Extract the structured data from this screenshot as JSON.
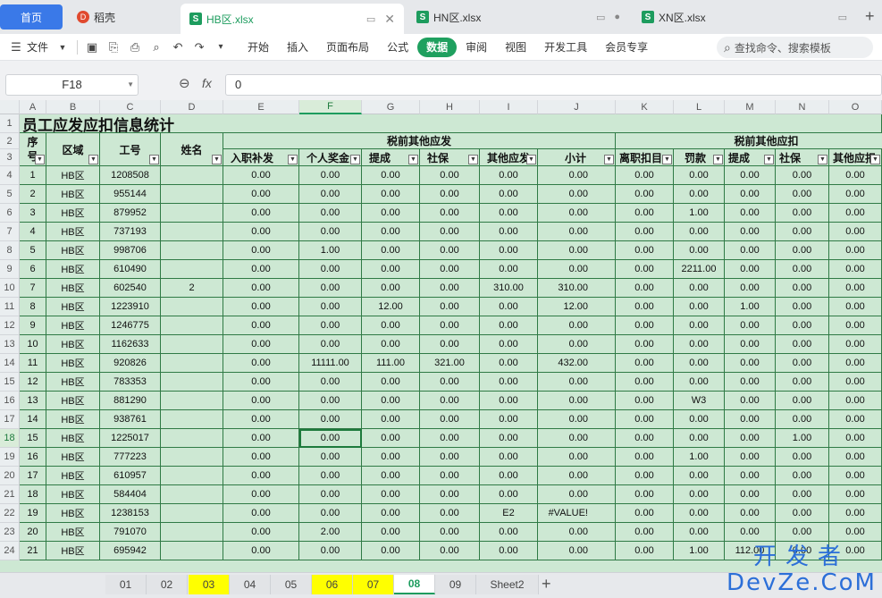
{
  "tabs": {
    "home": "首页",
    "docer": "稻壳",
    "files": [
      {
        "name": "HB区.xlsx",
        "active": true
      },
      {
        "name": "HN区.xlsx",
        "active": false
      },
      {
        "name": "XN区.xlsx",
        "active": false
      }
    ],
    "add": "+"
  },
  "menu": {
    "file": "文件",
    "items": [
      "开始",
      "插入",
      "页面布局",
      "公式",
      "数据",
      "审阅",
      "视图",
      "开发工具",
      "会员专享"
    ],
    "active": "数据",
    "search_placeholder": "查找命令、搜索模板"
  },
  "formula_bar": {
    "cell_ref": "F18",
    "fx": "fx",
    "value": "0"
  },
  "columns": [
    "A",
    "B",
    "C",
    "D",
    "E",
    "F",
    "G",
    "H",
    "I",
    "J",
    "K",
    "L",
    "M",
    "N",
    "O"
  ],
  "selected_column": "F",
  "title": "员工应发应扣信息统计",
  "header": {
    "seq": "序号",
    "seq_top": "序",
    "seq_bottom": "号",
    "region": "区域",
    "id": "工号",
    "name": "姓名",
    "group1": "税前其他应发",
    "group2": "税前其他应扣",
    "sub1": [
      "入职补发",
      "个人奖金",
      "提成",
      "社保",
      "其他应发",
      "小计"
    ],
    "sub2": [
      "离职扣目",
      "罚款",
      "提成",
      "社保",
      "其他应扣"
    ]
  },
  "rows": [
    {
      "r": "4",
      "seq": "1",
      "region": "HB区",
      "id": "1208508",
      "name": "",
      "v": [
        "0.00",
        "0.00",
        "0.00",
        "0.00",
        "0.00",
        "0.00",
        "0.00",
        "0.00",
        "0.00",
        "0.00",
        "0.00"
      ]
    },
    {
      "r": "5",
      "seq": "2",
      "region": "HB区",
      "id": "955144",
      "name": "",
      "v": [
        "0.00",
        "0.00",
        "0.00",
        "0.00",
        "0.00",
        "0.00",
        "0.00",
        "0.00",
        "0.00",
        "0.00",
        "0.00"
      ]
    },
    {
      "r": "6",
      "seq": "3",
      "region": "HB区",
      "id": "879952",
      "name": "",
      "v": [
        "0.00",
        "0.00",
        "0.00",
        "0.00",
        "0.00",
        "0.00",
        "0.00",
        "1.00",
        "0.00",
        "0.00",
        "0.00"
      ]
    },
    {
      "r": "7",
      "seq": "4",
      "region": "HB区",
      "id": "737193",
      "name": "",
      "v": [
        "0.00",
        "0.00",
        "0.00",
        "0.00",
        "0.00",
        "0.00",
        "0.00",
        "0.00",
        "0.00",
        "0.00",
        "0.00"
      ]
    },
    {
      "r": "8",
      "seq": "5",
      "region": "HB区",
      "id": "998706",
      "name": "",
      "v": [
        "0.00",
        "1.00",
        "0.00",
        "0.00",
        "0.00",
        "0.00",
        "0.00",
        "0.00",
        "0.00",
        "0.00",
        "0.00"
      ]
    },
    {
      "r": "9",
      "seq": "6",
      "region": "HB区",
      "id": "610490",
      "name": "",
      "v": [
        "0.00",
        "0.00",
        "0.00",
        "0.00",
        "0.00",
        "0.00",
        "0.00",
        "2211.00",
        "0.00",
        "0.00",
        "0.00"
      ]
    },
    {
      "r": "10",
      "seq": "7",
      "region": "HB区",
      "id": "602540",
      "name": "2",
      "v": [
        "0.00",
        "0.00",
        "0.00",
        "0.00",
        "310.00",
        "310.00",
        "0.00",
        "0.00",
        "0.00",
        "0.00",
        "0.00"
      ]
    },
    {
      "r": "11",
      "seq": "8",
      "region": "HB区",
      "id": "1223910",
      "name": "",
      "v": [
        "0.00",
        "0.00",
        "12.00",
        "0.00",
        "0.00",
        "12.00",
        "0.00",
        "0.00",
        "1.00",
        "0.00",
        "0.00"
      ]
    },
    {
      "r": "12",
      "seq": "9",
      "region": "HB区",
      "id": "1246775",
      "name": "",
      "v": [
        "0.00",
        "0.00",
        "0.00",
        "0.00",
        "0.00",
        "0.00",
        "0.00",
        "0.00",
        "0.00",
        "0.00",
        "0.00"
      ]
    },
    {
      "r": "13",
      "seq": "10",
      "region": "HB区",
      "id": "1162633",
      "name": "",
      "v": [
        "0.00",
        "0.00",
        "0.00",
        "0.00",
        "0.00",
        "0.00",
        "0.00",
        "0.00",
        "0.00",
        "0.00",
        "0.00"
      ]
    },
    {
      "r": "14",
      "seq": "11",
      "region": "HB区",
      "id": "920826",
      "name": "",
      "v": [
        "0.00",
        "11111.00",
        "111.00",
        "321.00",
        "0.00",
        "432.00",
        "0.00",
        "0.00",
        "0.00",
        "0.00",
        "0.00"
      ]
    },
    {
      "r": "15",
      "seq": "12",
      "region": "HB区",
      "id": "783353",
      "name": "",
      "v": [
        "0.00",
        "0.00",
        "0.00",
        "0.00",
        "0.00",
        "0.00",
        "0.00",
        "0.00",
        "0.00",
        "0.00",
        "0.00"
      ]
    },
    {
      "r": "16",
      "seq": "13",
      "region": "HB区",
      "id": "881290",
      "name": "",
      "v": [
        "0.00",
        "0.00",
        "0.00",
        "0.00",
        "0.00",
        "0.00",
        "0.00",
        "W3",
        "0.00",
        "0.00",
        "0.00"
      ]
    },
    {
      "r": "17",
      "seq": "14",
      "region": "HB区",
      "id": "938761",
      "name": "",
      "v": [
        "0.00",
        "0.00",
        "0.00",
        "0.00",
        "0.00",
        "0.00",
        "0.00",
        "0.00",
        "0.00",
        "0.00",
        "0.00"
      ]
    },
    {
      "r": "18",
      "seq": "15",
      "region": "HB区",
      "id": "1225017",
      "name": "",
      "v": [
        "0.00",
        "0.00",
        "0.00",
        "0.00",
        "0.00",
        "0.00",
        "0.00",
        "0.00",
        "0.00",
        "1.00",
        "0.00"
      ]
    },
    {
      "r": "19",
      "seq": "16",
      "region": "HB区",
      "id": "777223",
      "name": "",
      "v": [
        "0.00",
        "0.00",
        "0.00",
        "0.00",
        "0.00",
        "0.00",
        "0.00",
        "1.00",
        "0.00",
        "0.00",
        "0.00"
      ]
    },
    {
      "r": "20",
      "seq": "17",
      "region": "HB区",
      "id": "610957",
      "name": "",
      "v": [
        "0.00",
        "0.00",
        "0.00",
        "0.00",
        "0.00",
        "0.00",
        "0.00",
        "0.00",
        "0.00",
        "0.00",
        "0.00"
      ]
    },
    {
      "r": "21",
      "seq": "18",
      "region": "HB区",
      "id": "584404",
      "name": "",
      "v": [
        "0.00",
        "0.00",
        "0.00",
        "0.00",
        "0.00",
        "0.00",
        "0.00",
        "0.00",
        "0.00",
        "0.00",
        "0.00"
      ]
    },
    {
      "r": "22",
      "seq": "19",
      "region": "HB区",
      "id": "1238153",
      "name": "",
      "v": [
        "0.00",
        "0.00",
        "0.00",
        "0.00",
        "E2",
        "#VALUE!",
        "0.00",
        "0.00",
        "0.00",
        "0.00",
        "0.00"
      ]
    },
    {
      "r": "23",
      "seq": "20",
      "region": "HB区",
      "id": "791070",
      "name": "",
      "v": [
        "0.00",
        "2.00",
        "0.00",
        "0.00",
        "0.00",
        "0.00",
        "0.00",
        "0.00",
        "0.00",
        "0.00",
        "0.00"
      ]
    },
    {
      "r": "24",
      "seq": "21",
      "region": "HB区",
      "id": "695942",
      "name": "",
      "v": [
        "0.00",
        "0.00",
        "0.00",
        "0.00",
        "0.00",
        "0.00",
        "0.00",
        "1.00",
        "112.00",
        "0.00",
        "0.00"
      ]
    }
  ],
  "selected_row": "18",
  "sheets": [
    {
      "name": "01",
      "style": "normal"
    },
    {
      "name": "02",
      "style": "normal"
    },
    {
      "name": "03",
      "style": "highlight"
    },
    {
      "name": "04",
      "style": "normal"
    },
    {
      "name": "05",
      "style": "normal"
    },
    {
      "name": "06",
      "style": "highlight"
    },
    {
      "name": "07",
      "style": "highlight"
    },
    {
      "name": "08",
      "style": "active"
    },
    {
      "name": "09",
      "style": "normal"
    },
    {
      "name": "Sheet2",
      "style": "normal"
    }
  ],
  "add_sheet": "+",
  "watermark": {
    "line1": "开发者",
    "line2": "DevZe.CoM"
  },
  "colors": {
    "accent": "#1d9c5e",
    "grid_bg": "#cde8d3",
    "sheet_highlight": "#ffff00",
    "home_tab": "#3a79e8"
  }
}
